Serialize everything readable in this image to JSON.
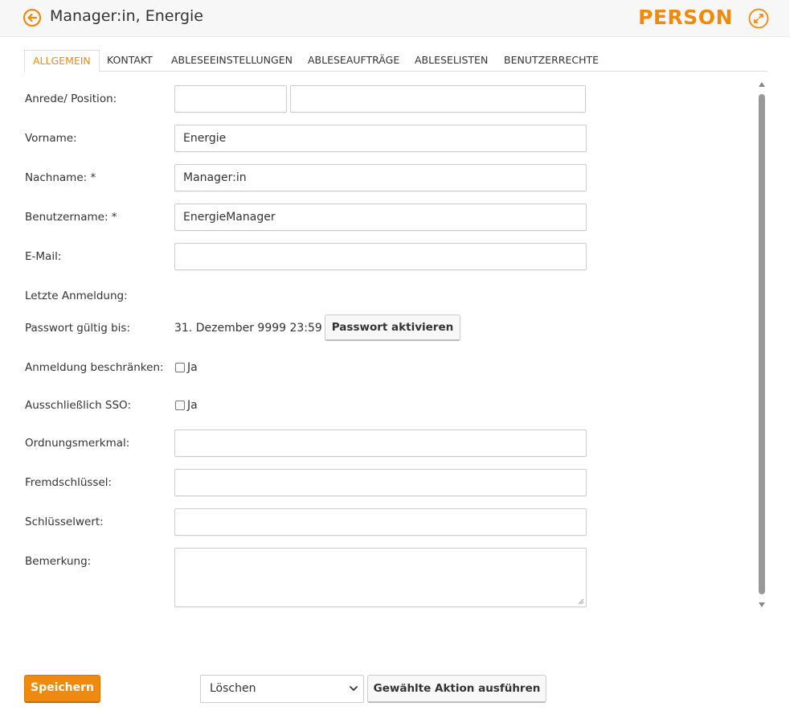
{
  "header": {
    "title": "Manager:in, Energie",
    "type_label": "PERSON",
    "back_icon": "arrow-left-circle-icon",
    "expand_icon": "expand-circle-icon",
    "accent_color": "#ef8a0f"
  },
  "tabs": [
    {
      "label": "ALLGEMEIN",
      "active": true
    },
    {
      "label": "KONTAKT",
      "active": false
    },
    {
      "label": "ABLESEEINSTELLUNGEN",
      "active": false
    },
    {
      "label": "ABLESEAUFTRÄGE",
      "active": false
    },
    {
      "label": "ABLESELISTEN",
      "active": false
    },
    {
      "label": "BENUTZERRECHTE",
      "active": false
    }
  ],
  "form": {
    "anrede": {
      "label": "Anrede/ Position:",
      "anrede_value": "",
      "position_value": ""
    },
    "vorname": {
      "label": "Vorname:",
      "value": "Energie"
    },
    "nachname": {
      "label": "Nachname: *",
      "value": "Manager:in"
    },
    "benutzername": {
      "label": "Benutzername: *",
      "value": "EnergieManager"
    },
    "email": {
      "label": "E-Mail:",
      "value": ""
    },
    "letzte_anmeldung": {
      "label": "Letzte Anmeldung:",
      "value": ""
    },
    "passwort": {
      "label": "Passwort gültig bis:",
      "value": "31. Dezember 9999 23:59",
      "button_label": "Passwort aktivieren"
    },
    "anmeldung_beschraenken": {
      "label": "Anmeldung beschränken:",
      "checkbox_label": "Ja",
      "checked": false
    },
    "sso": {
      "label": "Ausschließlich SSO:",
      "checkbox_label": "Ja",
      "checked": false
    },
    "ordnungsmerkmal": {
      "label": "Ordnungsmerkmal:",
      "value": ""
    },
    "fremdschluessel": {
      "label": "Fremdschlüssel:",
      "value": ""
    },
    "schluesselwert": {
      "label": "Schlüsselwert:",
      "value": ""
    },
    "bemerkung": {
      "label": "Bemerkung:",
      "value": ""
    }
  },
  "footer": {
    "save_label": "Speichern",
    "action_selected": "Löschen",
    "execute_label": "Gewählte Aktion ausführen"
  }
}
